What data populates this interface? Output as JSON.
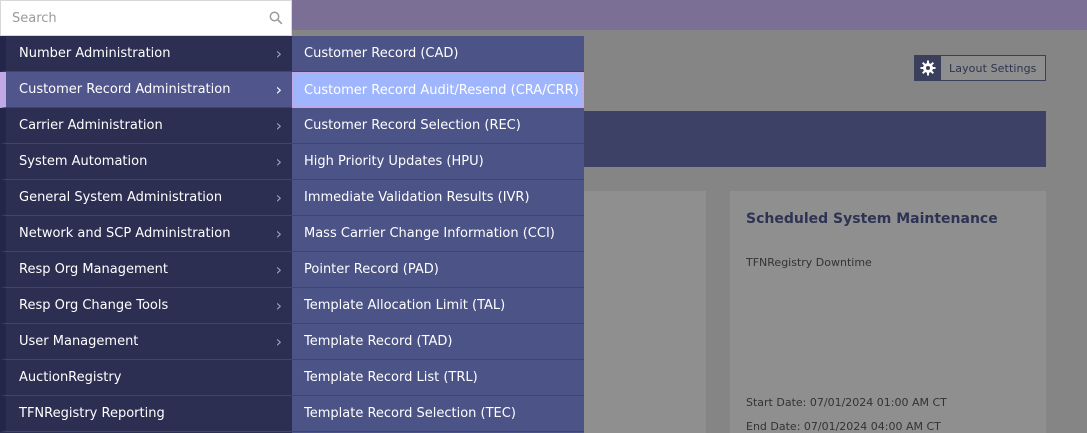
{
  "search": {
    "placeholder": "Search",
    "icon": "search-icon"
  },
  "layout_settings": {
    "label": "Layout Settings",
    "icon": "gear-icon"
  },
  "menu": {
    "items": [
      {
        "label": "Number Administration",
        "has_submenu": true,
        "active": false
      },
      {
        "label": "Customer Record Administration",
        "has_submenu": true,
        "active": true
      },
      {
        "label": "Carrier Administration",
        "has_submenu": true,
        "active": false
      },
      {
        "label": "System Automation",
        "has_submenu": true,
        "active": false
      },
      {
        "label": "General System Administration",
        "has_submenu": true,
        "active": false
      },
      {
        "label": "Network and SCP Administration",
        "has_submenu": true,
        "active": false
      },
      {
        "label": "Resp Org Management",
        "has_submenu": true,
        "active": false
      },
      {
        "label": "Resp Org Change Tools",
        "has_submenu": true,
        "active": false
      },
      {
        "label": "User Management",
        "has_submenu": true,
        "active": false
      },
      {
        "label": "AuctionRegistry",
        "has_submenu": false,
        "active": false
      },
      {
        "label": "TFNRegistry Reporting",
        "has_submenu": false,
        "active": false
      }
    ]
  },
  "submenu": {
    "items": [
      {
        "label": "Customer Record (CAD)",
        "active": false
      },
      {
        "label": "Customer Record Audit/Resend (CRA/CRR)",
        "active": true
      },
      {
        "label": "Customer Record Selection (REC)",
        "active": false
      },
      {
        "label": "High Priority Updates (HPU)",
        "active": false
      },
      {
        "label": "Immediate Validation Results (IVR)",
        "active": false
      },
      {
        "label": "Mass Carrier Change Information (CCI)",
        "active": false
      },
      {
        "label": "Pointer Record (PAD)",
        "active": false
      },
      {
        "label": "Template Allocation Limit (TAL)",
        "active": false
      },
      {
        "label": "Template Record (TAD)",
        "active": false
      },
      {
        "label": "Template Record List (TRL)",
        "active": false
      },
      {
        "label": "Template Record Selection (TEC)",
        "active": false
      }
    ]
  },
  "maintenance_card": {
    "title": "Scheduled System Maintenance",
    "subtitle": "TFNRegistry Downtime",
    "start_date": "Start Date:  07/01/2024 01:00 AM CT",
    "end_date": "End Date:  07/01/2024 04:00 AM CT"
  },
  "colors": {
    "topbar": "#7c6f96",
    "menu_bg": "#2c2f52",
    "submenu_bg": "#4b5387",
    "active_highlight": "#9fb6ff",
    "accent": "#c1a9e6"
  }
}
